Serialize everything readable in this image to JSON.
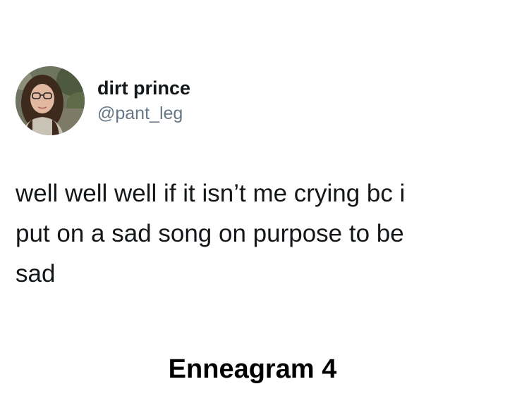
{
  "user": {
    "display_name": "dirt prince",
    "handle": "@pant_leg",
    "avatar_icon": "profile-photo"
  },
  "tweet": {
    "lines": [
      "well well well if it isn’t me crying bc i",
      "put on a sad song on purpose to be",
      "sad"
    ]
  },
  "caption": "Enneagram 4",
  "colors": {
    "text": "#14171a",
    "handle": "#657786",
    "background": "#ffffff",
    "caption": "#000000"
  }
}
